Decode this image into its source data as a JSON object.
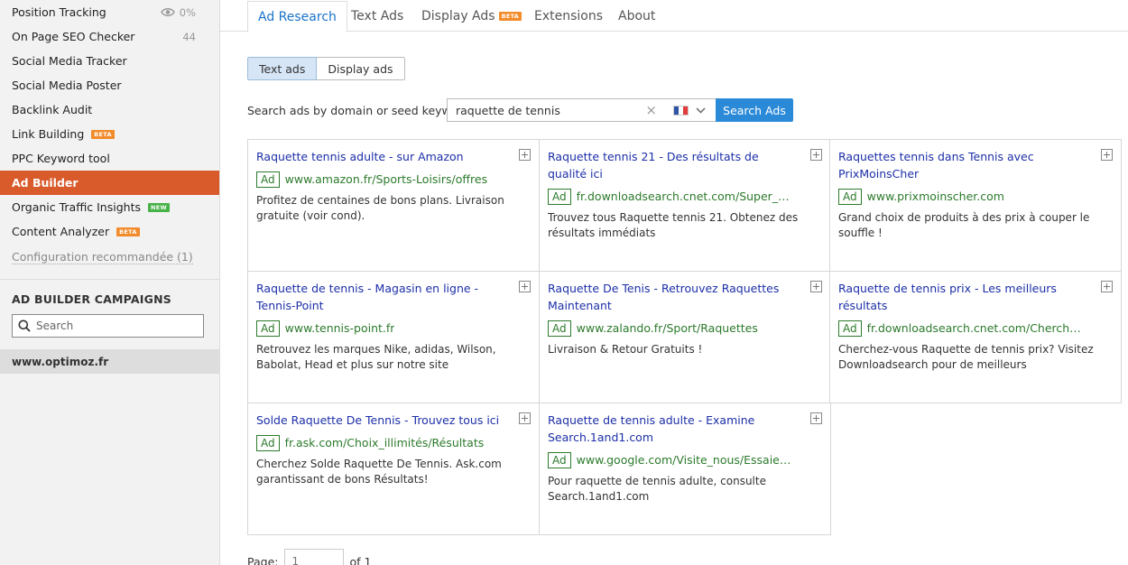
{
  "sidebar": {
    "items": [
      {
        "label": "Position Tracking",
        "meta": "0%",
        "icon": "eye-icon"
      },
      {
        "label": "On Page SEO Checker",
        "meta": "44"
      },
      {
        "label": "Social Media Tracker"
      },
      {
        "label": "Social Media Poster"
      },
      {
        "label": "Backlink Audit"
      },
      {
        "label": "Link Building",
        "badge": "BETA"
      },
      {
        "label": "PPC Keyword tool"
      },
      {
        "label": "Ad Builder",
        "active": true
      },
      {
        "label": "Organic Traffic Insights",
        "badge": "NEW"
      },
      {
        "label": "Content Analyzer",
        "badge": "BETA"
      }
    ],
    "config_link": "Configuration recommandée (1)",
    "campaigns_heading": "AD BUILDER CAMPAIGNS",
    "search_placeholder": "Search",
    "domain": "www.optimoz.fr"
  },
  "tabs": [
    {
      "label": "Ad Research",
      "active": true
    },
    {
      "label": "Text Ads"
    },
    {
      "label": "Display Ads",
      "badge": "BETA"
    },
    {
      "label": "Extensions"
    },
    {
      "label": "About"
    }
  ],
  "toggle": {
    "text_ads": "Text ads",
    "display_ads": "Display ads"
  },
  "search": {
    "label": "Search ads by domain or seed keyword:",
    "value": "raquette de tennis",
    "button": "Search Ads",
    "country": "France"
  },
  "ad_tag": "Ad",
  "ads": [
    {
      "title": "Raquette tennis adulte - sur Amazon",
      "url": "www.amazon.fr/Sports-Loisirs/offres",
      "desc": "Profitez de centaines de bons plans. Livraison gratuite (voir cond)."
    },
    {
      "title": "Raquette tennis 21 - Des résultats de qualité ici",
      "url": "fr.downloadsearch.cnet.com/Super_résult…",
      "desc": "Trouvez tous Raquette tennis 21. Obtenez des résultats immédiats"
    },
    {
      "title": "Raquettes tennis dans Tennis avec PrixMoinsCher",
      "url": "www.prixmoinscher.com",
      "desc": "Grand choix de produits à des prix à couper le souffle !"
    },
    {
      "title": "Raquette de tennis - Magasin en ligne -Tennis-Point",
      "url": "www.tennis-point.fr",
      "desc": "Retrouvez les marques Nike, adidas, Wilson, Babolat, Head et plus sur notre site"
    },
    {
      "title": "Raquette De Tenis - Retrouvez Raquettes Maintenant",
      "url": "www.zalando.fr/Sport/Raquettes",
      "desc": "Livraison & Retour Gratuits !"
    },
    {
      "title": "Raquette de tennis prix - Les meilleurs résultats",
      "url": "fr.downloadsearch.cnet.com/Cherchez-CB…",
      "desc": "Cherchez-vous Raquette de tennis prix? Visitez Downloadsearch pour de meilleurs"
    },
    {
      "title": "Solde Raquette De Tennis - Trouvez tous ici",
      "url": "fr.ask.com/Choix_illimités/Résultats",
      "desc": "Cherchez Solde Raquette De Tennis. Ask.com garantissant de bons Résultats!"
    },
    {
      "title": "Raquette de tennis adulte - Examine Search.1and1.com",
      "url": "www.google.com/Visite_nous/Essaie_le",
      "desc": "Pour raquette de tennis adulte, consulte Search.1and1.com"
    }
  ],
  "pager": {
    "label": "Page:",
    "value": "1",
    "of": "of 1"
  },
  "colors": {
    "accent": "#d95a2b",
    "link": "#1c2fa8",
    "url": "#2c7a2c",
    "button": "#2b8ad8"
  }
}
